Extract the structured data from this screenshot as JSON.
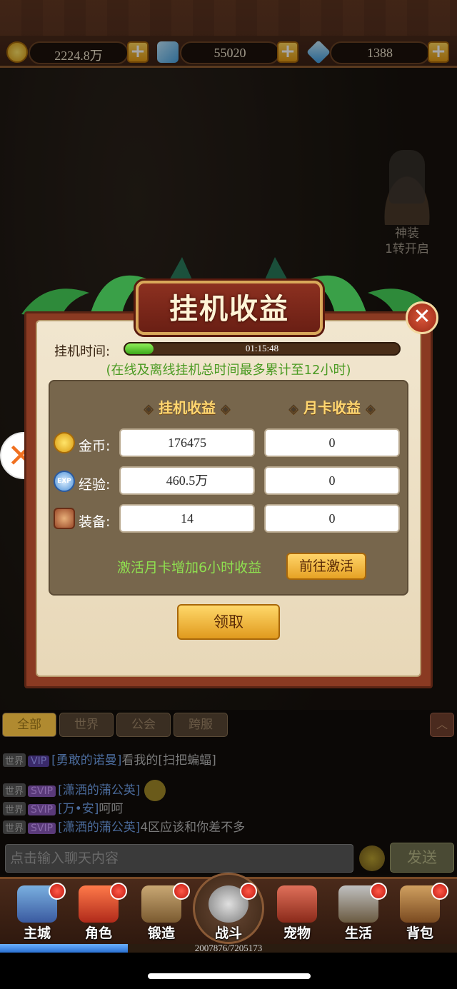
{
  "resources": {
    "gold": "2224.8万",
    "bound_diamond": "55020",
    "diamond": "1388"
  },
  "side_feature": {
    "line1": "神装",
    "line2": "1转开启"
  },
  "dialog": {
    "title": "挂机收益",
    "close_icon": "close-icon",
    "timer_label": "挂机时间:",
    "timer_value": "01:15:48",
    "timer_progress_fraction": 0.105,
    "timer_note": "(在线及离线挂机总时间最多累计至12小时)",
    "col_idle": "挂机收益",
    "col_monthly": "月卡收益",
    "rows": [
      {
        "label": "金币:",
        "icon": "gold-coin-icon",
        "idle": "176475",
        "monthly": "0"
      },
      {
        "label": "经验:",
        "icon": "exp-icon",
        "icon_text": "EXP",
        "idle": "460.5万",
        "monthly": "0"
      },
      {
        "label": "装备:",
        "icon": "equipment-icon",
        "idle": "14",
        "monthly": "0"
      }
    ],
    "activate_hint": "激活月卡增加6小时收益",
    "activate_button": "前往激活",
    "claim_button": "领取"
  },
  "chat": {
    "tabs": [
      "全部",
      "世界",
      "公会",
      "跨服"
    ],
    "lines": [
      {
        "channel": "世界",
        "badge": "VIP",
        "name": "[勇敢的诺曼]",
        "text": "看我的[扫把蝙蝠]"
      },
      {
        "channel": "世界",
        "badge": "SVIP",
        "name": "[潇洒的蒲公英]",
        "text": ""
      },
      {
        "channel": "世界",
        "badge": "SVIP",
        "name": "[万•安]",
        "text": "呵呵"
      },
      {
        "channel": "世界",
        "badge": "SVIP",
        "name": "[潇洒的蒲公英]",
        "text": "4区应该和你差不多"
      }
    ],
    "input_placeholder": "点击输入聊天内容",
    "send_button": "发送"
  },
  "nav": {
    "items": [
      "主城",
      "角色",
      "锻造",
      "战斗",
      "宠物",
      "生活",
      "背包"
    ]
  },
  "experience": {
    "text": "2007876/7205173",
    "fraction": 0.279
  },
  "colors": {
    "accent_gold": "#e39a12",
    "note_green": "#4a9a22",
    "panel_red": "#8a3a22"
  }
}
